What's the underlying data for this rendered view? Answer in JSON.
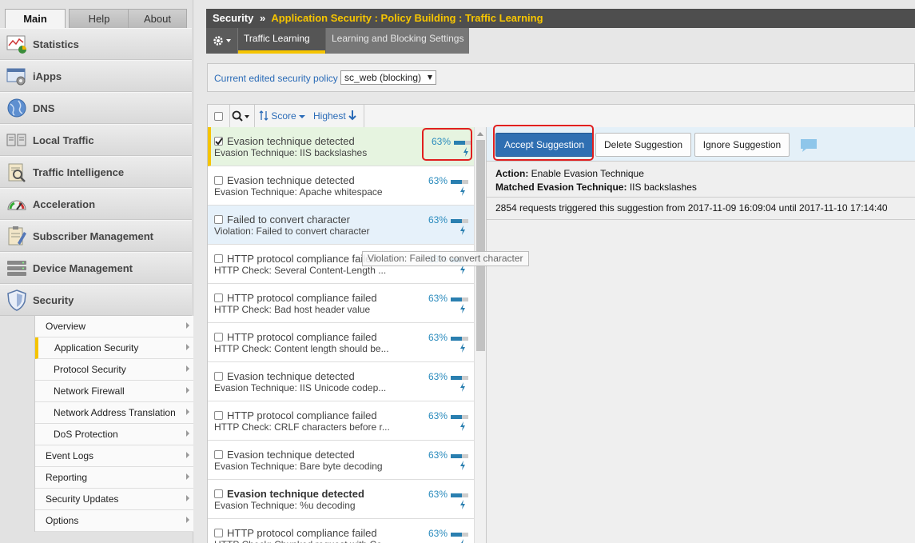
{
  "nav_tabs": {
    "main": "Main",
    "help": "Help",
    "about": "About"
  },
  "nav": [
    {
      "label": "Statistics",
      "icon": "statistics-icon"
    },
    {
      "label": "iApps",
      "icon": "iapps-icon"
    },
    {
      "label": "DNS",
      "icon": "dns-globe-icon"
    },
    {
      "label": "Local Traffic",
      "icon": "local-traffic-icon"
    },
    {
      "label": "Traffic Intelligence",
      "icon": "traffic-intelligence-icon"
    },
    {
      "label": "Acceleration",
      "icon": "acceleration-gauge-icon"
    },
    {
      "label": "Subscriber Management",
      "icon": "subscriber-management-icon"
    },
    {
      "label": "Device Management",
      "icon": "device-management-icon"
    },
    {
      "label": "Security",
      "icon": "security-shield-icon"
    }
  ],
  "security_submenu": [
    "Overview",
    "Application Security",
    "Protocol Security",
    "Network Firewall",
    "Network Address Translation",
    "DoS Protection",
    "Event Logs",
    "Reporting",
    "Security Updates",
    "Options"
  ],
  "header": {
    "section": "Security",
    "separator": "»",
    "path": "Application Security : Policy Building : Traffic Learning"
  },
  "subtabs": {
    "traffic_learning": "Traffic Learning",
    "learning_blocking": "Learning and Blocking Settings"
  },
  "policy": {
    "label": "Current edited security policy",
    "value": "sc_web (blocking)"
  },
  "toolbar": {
    "score": "Score",
    "highest": "Highest"
  },
  "suggestions": [
    {
      "title": "Evasion technique detected",
      "detail": "Evasion Technique: IIS backslashes",
      "score": "63%",
      "score_value": 0.63,
      "checked": true,
      "bold": false
    },
    {
      "title": "Evasion technique detected",
      "detail": "Evasion Technique: Apache whitespace",
      "score": "63%",
      "score_value": 0.63,
      "checked": false,
      "bold": false
    },
    {
      "title": "Failed to convert character",
      "detail": "Violation: Failed to convert character",
      "score": "63%",
      "score_value": 0.63,
      "checked": false,
      "bold": false
    },
    {
      "title": "HTTP protocol compliance failed",
      "detail": "HTTP Check: Several Content-Length ...",
      "score": "63%",
      "score_value": 0.63,
      "checked": false,
      "bold": false
    },
    {
      "title": "HTTP protocol compliance failed",
      "detail": "HTTP Check: Bad host header value",
      "score": "63%",
      "score_value": 0.63,
      "checked": false,
      "bold": false
    },
    {
      "title": "HTTP protocol compliance failed",
      "detail": "HTTP Check: Content length should be...",
      "score": "63%",
      "score_value": 0.63,
      "checked": false,
      "bold": false
    },
    {
      "title": "Evasion technique detected",
      "detail": "Evasion Technique: IIS Unicode codep...",
      "score": "63%",
      "score_value": 0.63,
      "checked": false,
      "bold": false
    },
    {
      "title": "HTTP protocol compliance failed",
      "detail": "HTTP Check: CRLF characters before r...",
      "score": "63%",
      "score_value": 0.63,
      "checked": false,
      "bold": false
    },
    {
      "title": "Evasion technique detected",
      "detail": "Evasion Technique: Bare byte decoding",
      "score": "63%",
      "score_value": 0.63,
      "checked": false,
      "bold": false
    },
    {
      "title": "Evasion technique detected",
      "detail": "Evasion Technique: %u decoding",
      "score": "63%",
      "score_value": 0.63,
      "checked": false,
      "bold": true
    },
    {
      "title": "HTTP protocol compliance failed",
      "detail": "HTTP Check: Chunked request with Co...",
      "score": "63%",
      "score_value": 0.63,
      "checked": false,
      "bold": false
    }
  ],
  "tooltip": "Violation: Failed to convert character",
  "detail": {
    "accept": "Accept Suggestion",
    "delete": "Delete Suggestion",
    "ignore": "Ignore Suggestion",
    "action_label": "Action:",
    "action_value": "Enable Evasion Technique",
    "matched_label": "Matched Evasion Technique:",
    "matched_value": "IIS backslashes",
    "requests": "2854 requests triggered this suggestion from 2017-11-09 16:09:04 until 2017-11-10 17:14:40"
  },
  "colors": {
    "accent": "#f5c400",
    "link": "#2a6bb7",
    "accept_button": "#2f6fb2",
    "highlight": "#e01f1f"
  }
}
